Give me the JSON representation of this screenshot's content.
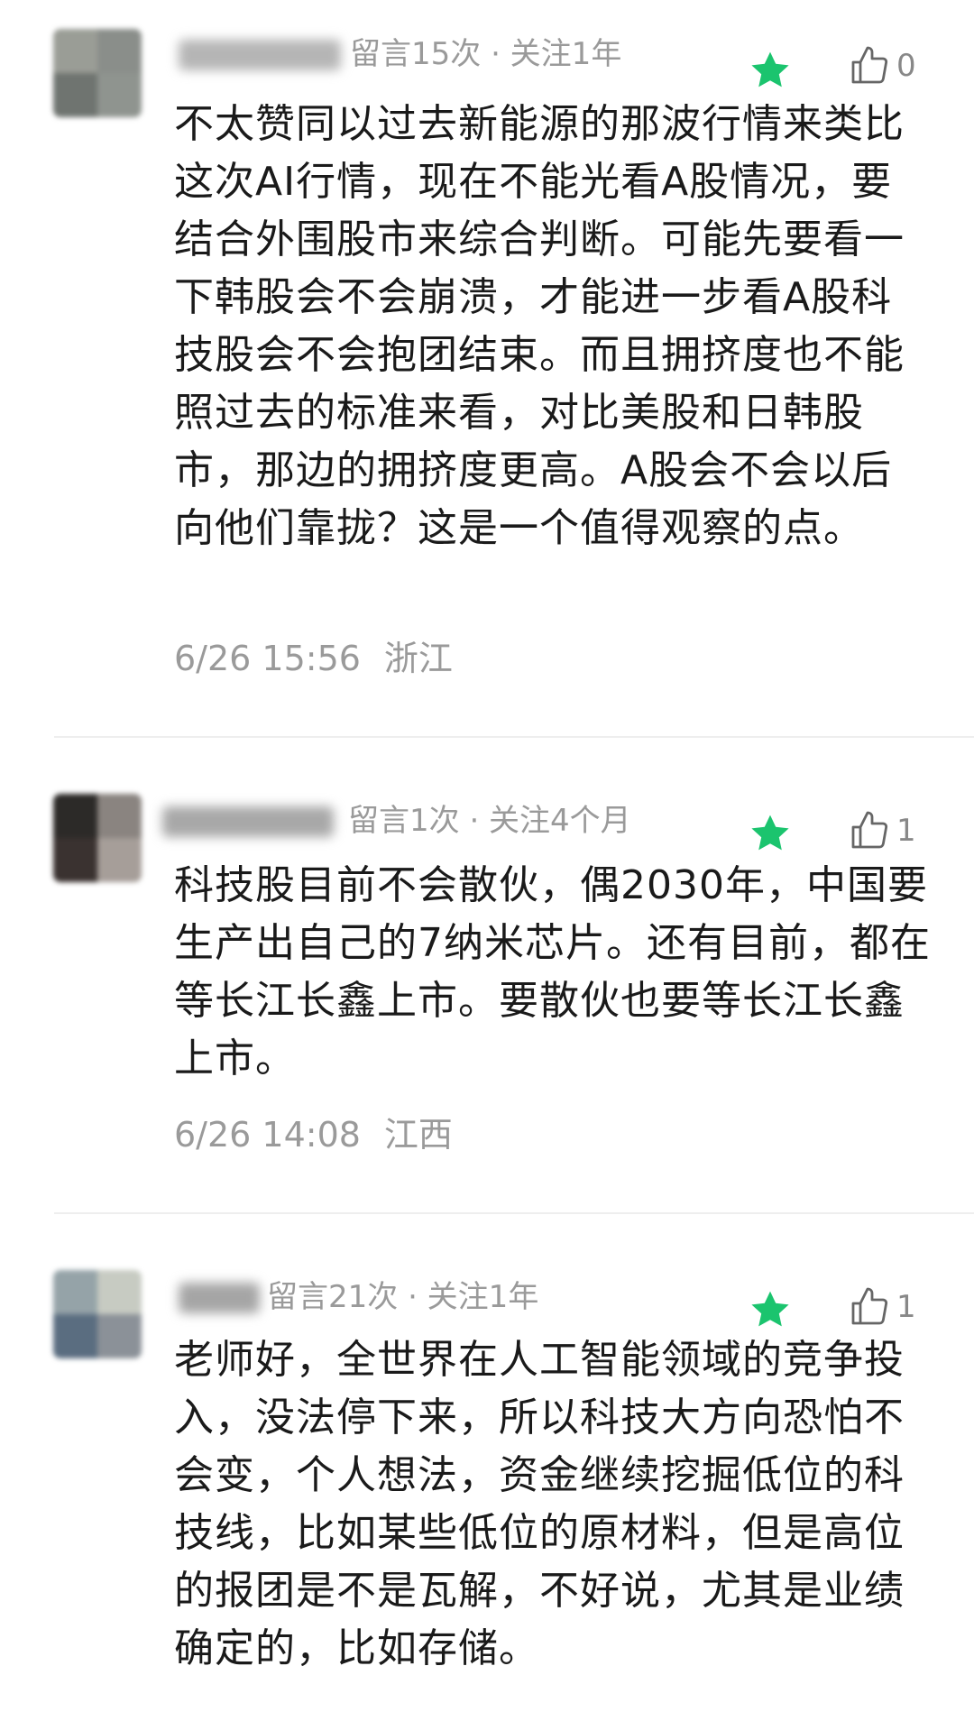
{
  "colors": {
    "star": "#1bc46e",
    "meta_text": "#9a9a9a",
    "body_text": "#1a1a1a",
    "divider": "#eeeeee"
  },
  "comments": [
    {
      "meta": "留言15次 · 关注1年",
      "likes": "0",
      "text": "不太赞同以过去新能源的那波行情来类比这次AI行情，现在不能光看A股情况，要结合外围股市来综合判断。可能先要看一下韩股会不会崩溃，才能进一步看A股科技股会不会抱团结束。而且拥挤度也不能照过去的标准来看，对比美股和日韩股市，那边的拥挤度更高。A股会不会以后向他们靠拢？这是一个值得观察的点。",
      "time": "6/26 15:56",
      "location": "浙江",
      "icons": [
        "star-icon",
        "thumbs-up-icon"
      ]
    },
    {
      "meta": "留言1次 · 关注4个月",
      "likes": "1",
      "text": "科技股目前不会散伙，偶2030年，中国要生产出自己的7纳米芯片。还有目前，都在等长江长鑫上市。要散伙也要等长江长鑫上市。",
      "time": "6/26 14:08",
      "location": "江西",
      "icons": [
        "star-icon",
        "thumbs-up-icon"
      ]
    },
    {
      "meta": "留言21次 · 关注1年",
      "likes": "1",
      "text": "老师好，全世界在人工智能领域的竞争投入，没法停下来，所以科技大方向恐怕不会变，个人想法，资金继续挖掘低位的科技线，比如某些低位的原材料，但是高位的报团是不是瓦解，不好说，尤其是业绩确定的，比如存储。",
      "icons": [
        "star-icon",
        "thumbs-up-icon"
      ]
    }
  ]
}
